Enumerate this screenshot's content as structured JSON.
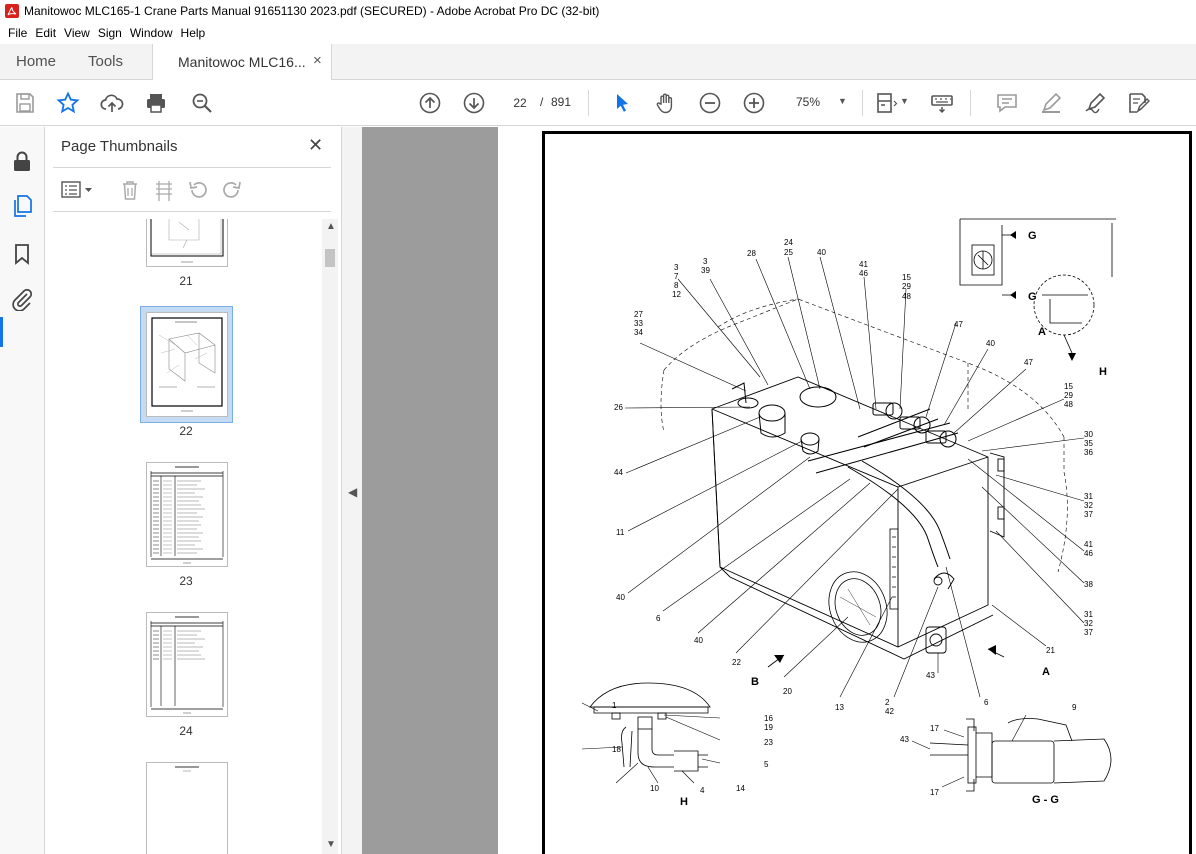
{
  "window": {
    "title": "Manitowoc MLC165-1 Crane Parts Manual 91651130 2023.pdf (SECURED) - Adobe Acrobat Pro DC (32-bit)"
  },
  "menu": [
    "File",
    "Edit",
    "View",
    "Sign",
    "Window",
    "Help"
  ],
  "tabs": {
    "home": "Home",
    "tools": "Tools",
    "document": "Manitowoc MLC16...",
    "close_glyph": "×"
  },
  "toolbar": {
    "current_page": "22",
    "page_separator": "/",
    "total_pages": "891",
    "zoom": "75%"
  },
  "thumbnails_panel": {
    "title": "Page Thumbnails",
    "close_glyph": "✕",
    "pages": [
      {
        "label": "21"
      },
      {
        "label": "22",
        "selected": true
      },
      {
        "label": "23"
      },
      {
        "label": "24"
      }
    ]
  },
  "diagram": {
    "callouts": [
      {
        "text": "3"
      },
      {
        "text": "7"
      },
      {
        "text": "8"
      },
      {
        "text": "12"
      },
      {
        "text": "3"
      },
      {
        "text": "39"
      },
      {
        "text": "24"
      },
      {
        "text": "25"
      },
      {
        "text": "28"
      },
      {
        "text": "40"
      },
      {
        "text": "41"
      },
      {
        "text": "46"
      },
      {
        "text": "15"
      },
      {
        "text": "29"
      },
      {
        "text": "48"
      },
      {
        "text": "27"
      },
      {
        "text": "33"
      },
      {
        "text": "34"
      },
      {
        "text": "47"
      },
      {
        "text": "40"
      },
      {
        "text": "47"
      },
      {
        "text": "15"
      },
      {
        "text": "29"
      },
      {
        "text": "48"
      },
      {
        "text": "26"
      },
      {
        "text": "44"
      },
      {
        "text": "11"
      },
      {
        "text": "30"
      },
      {
        "text": "35"
      },
      {
        "text": "36"
      },
      {
        "text": "31"
      },
      {
        "text": "32"
      },
      {
        "text": "37"
      },
      {
        "text": "41"
      },
      {
        "text": "46"
      },
      {
        "text": "38"
      },
      {
        "text": "31"
      },
      {
        "text": "32"
      },
      {
        "text": "37"
      },
      {
        "text": "40"
      },
      {
        "text": "6"
      },
      {
        "text": "40"
      },
      {
        "text": "21"
      },
      {
        "text": "22"
      },
      {
        "text": "20"
      },
      {
        "text": "13"
      },
      {
        "text": "2"
      },
      {
        "text": "42"
      },
      {
        "text": "43"
      },
      {
        "text": "6"
      },
      {
        "text": "1"
      },
      {
        "text": "16"
      },
      {
        "text": "19"
      },
      {
        "text": "23"
      },
      {
        "text": "18"
      },
      {
        "text": "5"
      },
      {
        "text": "10"
      },
      {
        "text": "4"
      },
      {
        "text": "14"
      },
      {
        "text": "9"
      },
      {
        "text": "43"
      },
      {
        "text": "17"
      },
      {
        "text": "17"
      }
    ],
    "view_labels": {
      "A": "A",
      "A2": "A",
      "B": "B",
      "G1": "G",
      "G2": "G",
      "H": "H",
      "H2": "H",
      "GG": "G - G"
    }
  }
}
